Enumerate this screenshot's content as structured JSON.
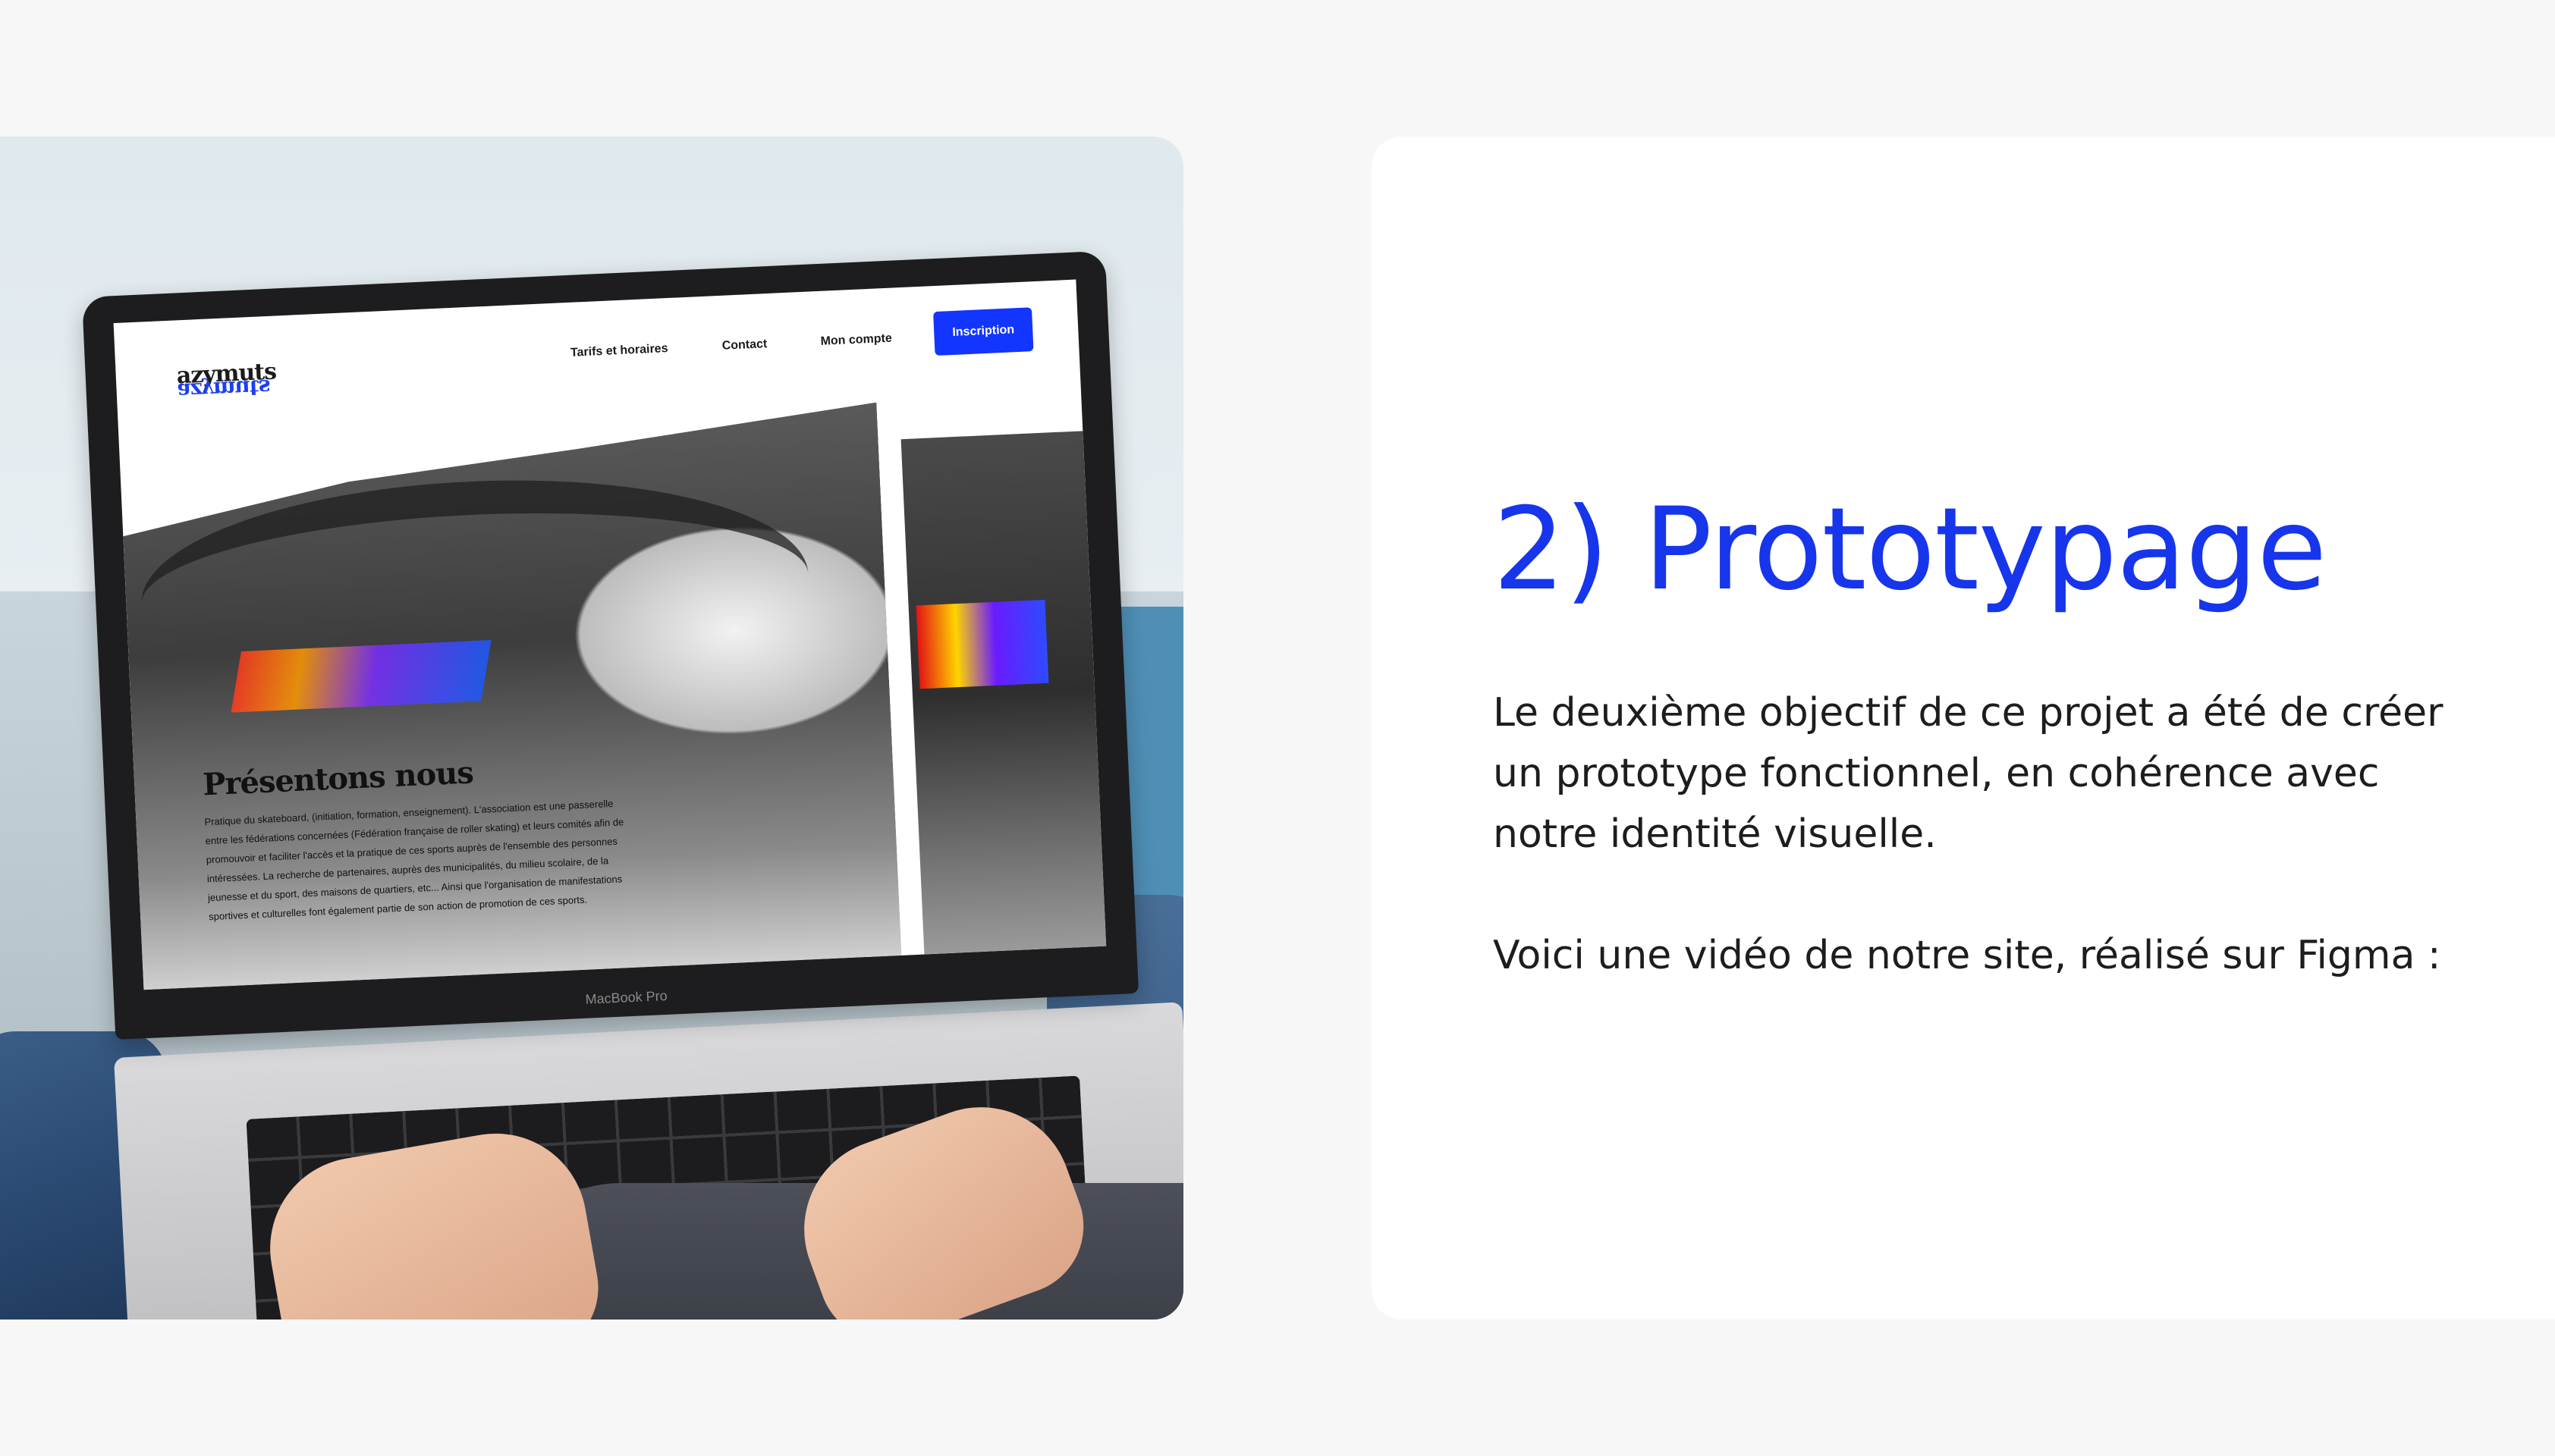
{
  "laptop": {
    "brand": "MacBook Pro"
  },
  "site": {
    "logo": "azymuts",
    "nav": {
      "tarifs": "Tarifs et horaires",
      "contact": "Contact",
      "account": "Mon compte",
      "signup": "Inscription"
    },
    "hero_title": "Présentons nous",
    "hero_text": "Pratique du skateboard, (initiation, formation, enseignement). L'association est une passerelle entre les fédérations concernées (Fédération française de roller skating) et leurs comités afin de promouvoir et faciliter l'accès et la pratique de ces sports auprès de l'ensemble des personnes intéressées. La recherche de partenaires, auprès des municipalités, du milieu scolaire, de la jeunesse et du sport, des maisons de quartiers, etc... Ainsi que l'organisation de manifestations sportives et culturelles font également partie de son action de promotion de ces sports."
  },
  "section": {
    "title": "2) Prototypage",
    "paragraph1": "Le deuxième objectif de ce projet a été de créer un prototype fonctionnel, en cohérence avec notre identité visuelle.",
    "paragraph2": "Voici une vidéo de notre site, réalisé sur Figma :"
  },
  "colors": {
    "accent": "#1735ea",
    "background": "#f7f7f7",
    "card": "#ffffff",
    "text": "#1d1d1d"
  }
}
